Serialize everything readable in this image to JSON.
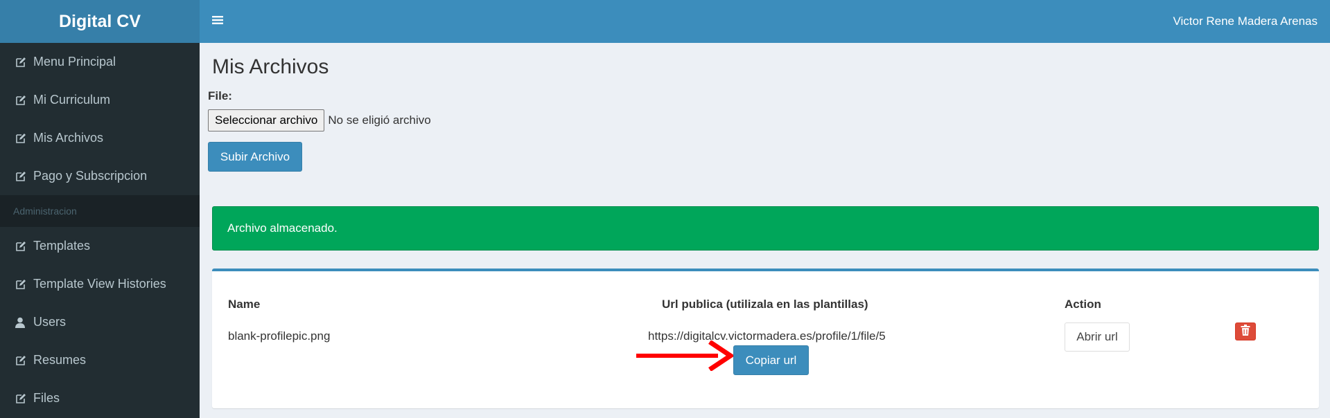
{
  "app": {
    "brand": "Digital CV",
    "user_name": "Victor Rene Madera Arenas"
  },
  "sidebar": {
    "items": [
      {
        "label": "Menu Principal",
        "icon": "edit-icon"
      },
      {
        "label": "Mi Curriculum",
        "icon": "edit-icon"
      },
      {
        "label": "Mis Archivos",
        "icon": "edit-icon"
      },
      {
        "label": "Pago y Subscripcion",
        "icon": "edit-icon"
      }
    ],
    "section_header": "Administracion",
    "admin_items": [
      {
        "label": "Templates",
        "icon": "edit-icon"
      },
      {
        "label": "Template View Histories",
        "icon": "edit-icon"
      },
      {
        "label": "Users",
        "icon": "user-icon"
      },
      {
        "label": "Resumes",
        "icon": "edit-icon"
      },
      {
        "label": "Files",
        "icon": "edit-icon"
      }
    ]
  },
  "page": {
    "title": "Mis Archivos",
    "file_label": "File:",
    "file_button": "Seleccionar archivo",
    "file_status": "No se eligió archivo",
    "upload_button": "Subir Archivo"
  },
  "alert": {
    "message": "Archivo almacenado.",
    "color": "#00a65a"
  },
  "table": {
    "headers": {
      "name": "Name",
      "url": "Url publica (utilizala en las plantillas)",
      "action": "Action"
    },
    "rows": [
      {
        "name": "blank-profilepic.png",
        "url": "https://digitalcv.victormadera.es/profile/1/file/5",
        "copy_button": "Copiar url",
        "open_button": "Abrir url"
      }
    ]
  },
  "colors": {
    "accent": "#3c8dbc",
    "sidebar": "#222d32",
    "danger": "#dd4b39",
    "annotation_arrow": "#ff0000"
  }
}
